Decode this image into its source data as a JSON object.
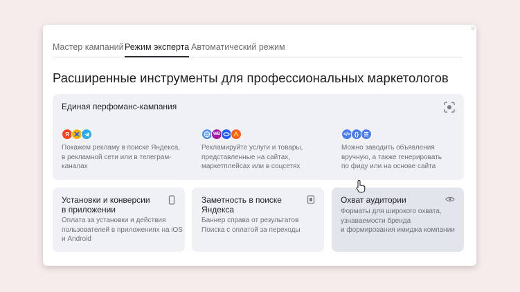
{
  "tabs": [
    {
      "label": "Мастер кампаний"
    },
    {
      "label": "Режим эксперта"
    },
    {
      "label": "Автоматический режим"
    }
  ],
  "heading": "Расширенные инструменты для профессиональных маркетологов",
  "unified_card": {
    "title": "Единая перфоманс-кампания",
    "columns": [
      {
        "icons": [
          "yandex-icon",
          "yandex-network-icon",
          "telegram-icon"
        ],
        "description": "Покажем рекламу в поиске Яндекса,\nв рекламной сети или в телеграм-\nканалах"
      },
      {
        "icons": [
          "globe-icon",
          "wildberries-icon",
          "ozon-icon",
          "marketplace-icon"
        ],
        "description": "Рекламируйте услуги и товары,\nпредставленные на сайтах,\nмаркетплейсах или в соцсетях"
      },
      {
        "icons": [
          "code-icon",
          "feed-braces-icon",
          "list-icon"
        ],
        "description": "Можно заводить объявления\nвручную, а также генерировать\nпо фиду или на основе сайта"
      }
    ]
  },
  "cards": [
    {
      "title": "Установки и конверсии\nв приложении",
      "description": "Оплата за установки и действия\nпользователей в приложениях на iOS\nи Android",
      "icon": "phone-icon"
    },
    {
      "title": "Заметность в поиске\nЯндекса",
      "description": "Баннер справа от результатов\nПоиска с оплатой за переходы",
      "icon": "banner-icon"
    },
    {
      "title": "Охват аудитории",
      "description": "Форматы для широкого охвата,\nузнаваемости бренда\nи формирования имиджа компании",
      "icon": "eye-icon"
    }
  ],
  "colors": {
    "yandex": "#fc3f1d",
    "yandex_network": "#f7b500",
    "telegram": "#2aabee",
    "globe": "#4a8cf7",
    "wildberries": "#a319a6",
    "ozon": "#1f5cff",
    "marketplace": "#ff5a1f",
    "code": "#4a7df0"
  }
}
